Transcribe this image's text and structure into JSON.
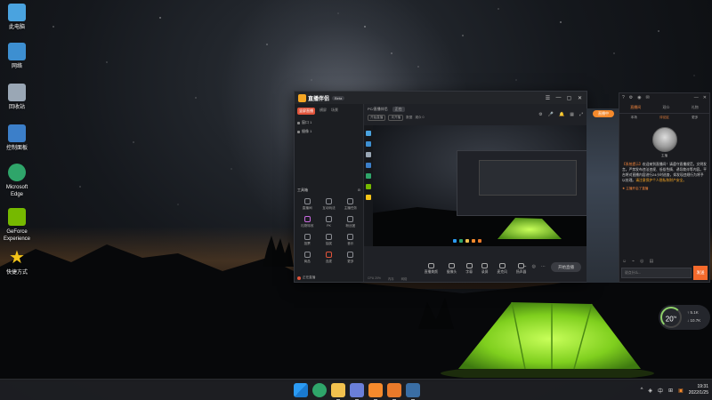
{
  "desktop": {
    "icons": [
      {
        "label": "此电脑",
        "icon": "this-pc-icon",
        "color": "#4aa3df"
      },
      {
        "label": "网络",
        "icon": "network-icon",
        "color": "#3d8fd1"
      },
      {
        "label": "回收站",
        "icon": "recycle-bin-icon",
        "color": "#9aa7b5"
      },
      {
        "label": "控制面板",
        "icon": "control-panel-icon",
        "color": "#3c7fc9"
      },
      {
        "label": "Microsoft Edge",
        "icon": "edge-icon",
        "color": "#2fa56a"
      },
      {
        "label": "GeForce Experience",
        "icon": "geforce-icon",
        "color": "#76b900"
      },
      {
        "label": "快捷方式",
        "icon": "star-shortcut-icon",
        "color": "#f5c518"
      }
    ]
  },
  "app": {
    "name": "直播伴侣",
    "version": "Beta",
    "title_controls": [
      "☰",
      "—",
      "▢",
      "✕"
    ],
    "scene_tabs": [
      {
        "label": "竖屏直播",
        "active": true
      },
      {
        "label": "横屏",
        "active": false
      },
      {
        "label": "场景",
        "active": false
      }
    ],
    "sources": [
      "窗口 1",
      "摄像 1"
    ],
    "tools_title": "工具箱",
    "tools": [
      "直播间",
      "互动玩法",
      "主播任务",
      "礼物特效",
      "PK",
      "粉丝团",
      "投票",
      "抽奖",
      "音乐",
      "商品",
      "连麦",
      "更多"
    ],
    "status_text": "正在直播",
    "room": {
      "title": "PC/直播伴侣",
      "badge": "正在",
      "tags": [
        "开始直播",
        "未开播",
        "数据",
        "观众 0"
      ],
      "icons": [
        "⚙",
        "🎤",
        "🔔",
        "▦",
        "⤢"
      ]
    },
    "controls": [
      "直播美颜",
      "摄像头",
      "字幕",
      "录屏",
      "麦克风",
      "扬声器"
    ],
    "side_controls": [
      "⌁",
      "◎",
      "⋯"
    ],
    "live_button": "开始直播",
    "footer": [
      "CPU 20%",
      "内存",
      "网络"
    ]
  },
  "side_button": "直播中",
  "chat": {
    "top_icons": [
      "?",
      "⚙",
      "◉",
      "✉",
      "—",
      "✕"
    ],
    "tabs": [
      {
        "label": "直播间",
        "active": true
      },
      {
        "label": "观众",
        "active": false
      },
      {
        "label": "礼物",
        "active": false
      }
    ],
    "subtabs": [
      {
        "label": "本场",
        "active": false
      },
      {
        "label": "评论区",
        "active": true
      },
      {
        "label": "更多",
        "active": false
      }
    ],
    "anchor_name": "主播",
    "notice_prefix": "【系统提示】",
    "notice_text": "欢迎来到直播间！请遵守直播规范，文明发言。严禁发布违法违规、低俗色情、诱导欺诈等内容。平台将对直播内容进行24小时巡查，如发现违规行为将予以处理。",
    "notice_highlight": "请注意保护个人隐私和财产安全。",
    "system_msg": "★ 主播开启了直播",
    "iconbar": [
      "☺",
      "⌁",
      "◎",
      "▤"
    ],
    "input_placeholder": "说点什么...",
    "send_label": "发送"
  },
  "perf": {
    "value": "20",
    "unit": "%",
    "up": "↑ 5.1K",
    "down": "↓ 10.7K",
    "color": "#8fd16a"
  },
  "taskbar": {
    "apps": [
      {
        "icon": "windows-start-icon",
        "color": "#2b9bf4"
      },
      {
        "icon": "edge-icon",
        "color": "#2fa56a"
      },
      {
        "icon": "file-explorer-icon",
        "color": "#f2c14e"
      },
      {
        "icon": "app-icon",
        "color": "#6a7fd9"
      },
      {
        "icon": "orange-app-icon",
        "color": "#f58a2c"
      },
      {
        "icon": "orange-app-icon-2",
        "color": "#e97a2a"
      },
      {
        "icon": "steam-icon",
        "color": "#3a6ea5"
      }
    ],
    "tray": [
      "^",
      "◈",
      "中",
      "⊞",
      "▣"
    ],
    "time": "19:31",
    "date": "2022/1/25"
  }
}
